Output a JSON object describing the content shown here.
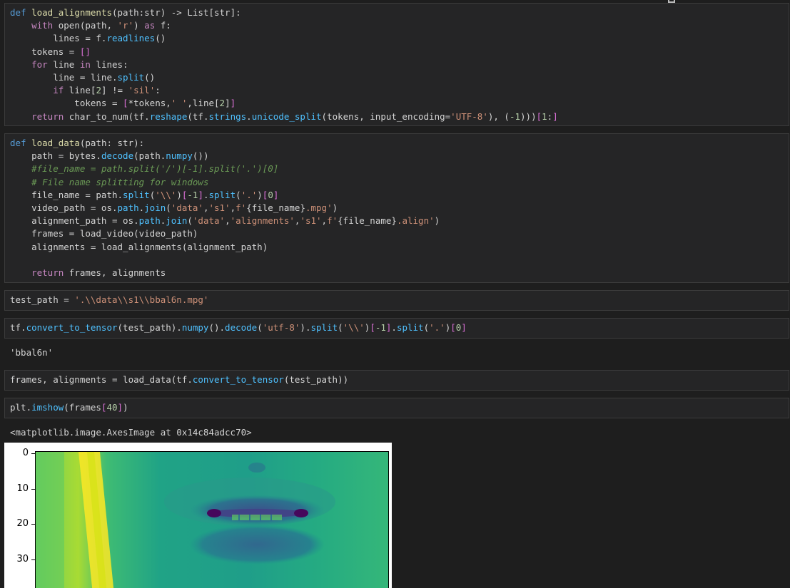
{
  "cells": {
    "load_alignments": {
      "lines": [
        "def load_alignments(path:str) -> List[str]:",
        "    with open(path, 'r') as f:",
        "        lines = f.readlines()",
        "    tokens = []",
        "    for line in lines:",
        "        line = line.split()",
        "        if line[2] != 'sil':",
        "            tokens = [*tokens,' ',line[2]]",
        "    return char_to_num(tf.reshape(tf.strings.unicode_split(tokens, input_encoding='UTF-8'), (-1)))[1:]"
      ]
    },
    "load_data": {
      "lines": [
        "def load_data(path: str):",
        "    path = bytes.decode(path.numpy())",
        "    #file_name = path.split('/')[-1].split('.')[0]",
        "    # File name splitting for windows",
        "    file_name = path.split('\\\\')[-1].split('.')[0]",
        "    video_path = os.path.join('data','s1',f'{file_name}.mpg')",
        "    alignment_path = os.path.join('data','alignments','s1',f'{file_name}.align')",
        "    frames = load_video(video_path)",
        "    alignments = load_alignments(alignment_path)",
        "",
        "    return frames, alignments"
      ]
    },
    "test_path": {
      "code": "test_path = '.\\\\data\\\\s1\\\\bbal6n.mpg'"
    },
    "convert": {
      "code": "tf.convert_to_tensor(test_path).numpy().decode('utf-8').split('\\\\')[-1].split('.')[0]",
      "output": "'bbal6n'"
    },
    "load_call": {
      "code": "frames, alignments = load_data(tf.convert_to_tensor(test_path))"
    },
    "imshow": {
      "code": "plt.imshow(frames[40])",
      "output": "<matplotlib.image.AxesImage at 0x14c84adcc70>"
    }
  },
  "figure": {
    "yticks": [
      "0",
      "10",
      "20",
      "30"
    ],
    "colormap": "viridis"
  }
}
